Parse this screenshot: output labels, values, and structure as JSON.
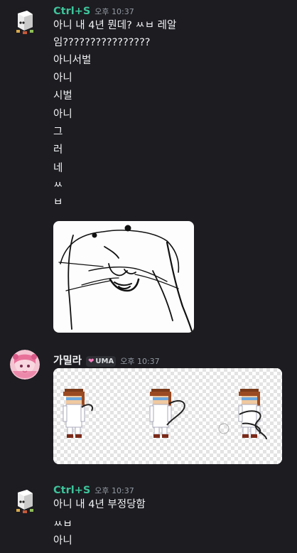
{
  "messages": [
    {
      "username": "Ctrl+S",
      "time_label": "오후 10:37",
      "lines": [
        "아니 내 4년 뭔데? ㅆㅂ 레알",
        "임????????????????",
        "아니서벌",
        "아니",
        "시벌",
        "아니",
        "그",
        "러",
        "네",
        "ㅆ",
        "ㅂ"
      ]
    },
    {
      "username": "가밀라",
      "tag": "UMA",
      "time_label": "오후 10:37"
    },
    {
      "username": "Ctrl+S",
      "time_label": "오후 10:37",
      "lines": [
        "아니 내 4년 부정당함",
        "ㅆㅂ",
        "아니"
      ]
    }
  ],
  "colors": {
    "background": "#1c1c21",
    "username_green": "#3fc39a",
    "timestamp": "#949ba4",
    "text": "#f2f3f5"
  }
}
